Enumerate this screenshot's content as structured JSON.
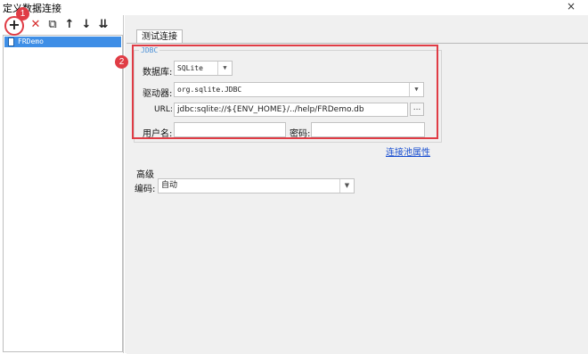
{
  "window": {
    "title": "定义数据连接",
    "close_icon": "×"
  },
  "toolbar": {
    "add_icon": "+",
    "delete_icon": "✕",
    "copy_icon": "⧉",
    "up_icon": "↑",
    "down_icon": "↓",
    "sort_icon": "⇊"
  },
  "tree": {
    "items": [
      {
        "label": "FRDemo"
      }
    ]
  },
  "tabs": [
    {
      "label": "测试连接"
    }
  ],
  "jdbc": {
    "legend": "JDBC",
    "database_label": "数据库:",
    "database_value": "SQLite",
    "driver_label": "驱动器:",
    "driver_value": "org.sqlite.JDBC",
    "url_label": "URL:",
    "url_value": "jdbc:sqlite://${ENV_HOME}/../help/FRDemo.db",
    "browse_label": "...",
    "username_label": "用户名:",
    "username_value": "",
    "password_label": "密码:",
    "password_value": ""
  },
  "pool_link": "连接池属性",
  "advanced": {
    "title": "高级",
    "encoding_label": "编码:",
    "encoding_value": "自动"
  },
  "annotations": {
    "badge1": "1",
    "badge2": "2"
  },
  "colors": {
    "highlight": "#e03c45",
    "selection": "#3e8ee6",
    "link": "#1a4fd0"
  }
}
